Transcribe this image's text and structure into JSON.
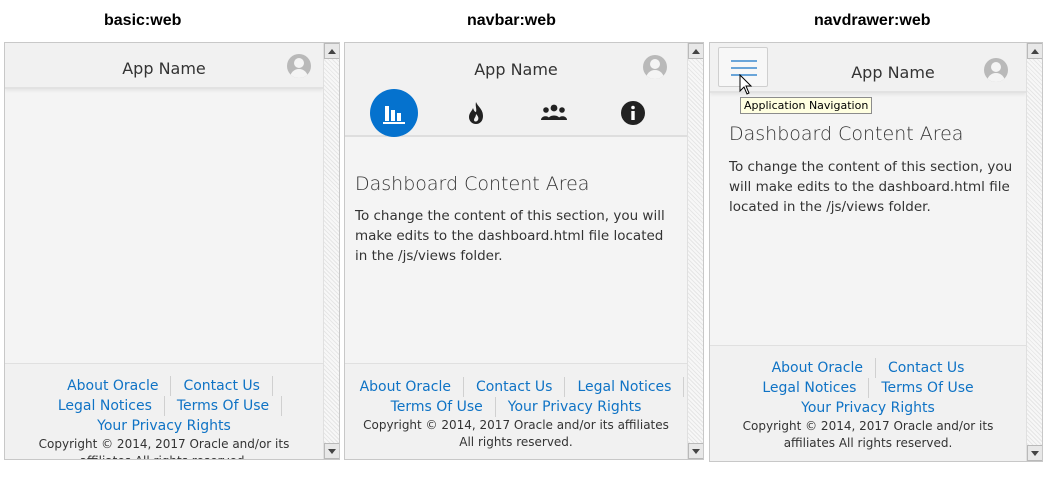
{
  "captions": {
    "basic": "basic:web",
    "navbar": "navbar:web",
    "navdrawer": "navdrawer:web"
  },
  "app": {
    "name": "App Name"
  },
  "content": {
    "title": "Dashboard Content Area",
    "text": "To change the content of this section, you will make edits to the dashboard.html file located in the /js/views folder."
  },
  "footer": {
    "about": "About Oracle",
    "contact": "Contact Us",
    "legal": "Legal Notices",
    "terms": "Terms Of Use",
    "privacy": "Your Privacy Rights",
    "copyright": "Copyright © 2014, 2017 Oracle and/or its affiliates All rights reserved."
  },
  "navbar": {
    "items": [
      {
        "icon": "bar-chart-icon",
        "selected": true
      },
      {
        "icon": "fire-icon",
        "selected": false
      },
      {
        "icon": "people-icon",
        "selected": false
      },
      {
        "icon": "info-icon",
        "selected": false
      }
    ]
  },
  "tooltip": {
    "text": "Application Navigation"
  },
  "colors": {
    "accent": "#0572ce",
    "link": "#0f73c5",
    "background": "#f4f4f4"
  }
}
